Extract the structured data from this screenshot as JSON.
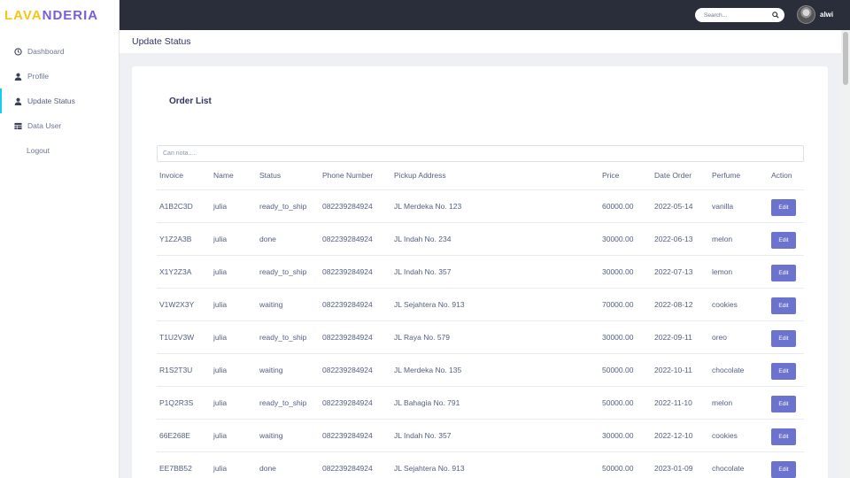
{
  "brand": {
    "name_part1": "LAVA",
    "name_part2": "NDERIA",
    "color_part1": "#f5c518",
    "color_part2": "#7b5cd6"
  },
  "sidebar": {
    "items": [
      {
        "label": "Dashboard",
        "icon": "clock-icon",
        "active": false
      },
      {
        "label": "Profile",
        "icon": "user-icon",
        "active": false
      },
      {
        "label": "Update Status",
        "icon": "user-icon",
        "active": true
      },
      {
        "label": "Data User",
        "icon": "table-icon",
        "active": false
      },
      {
        "label": "Logout",
        "icon": "",
        "active": false
      }
    ]
  },
  "topbar": {
    "search_placeholder": "Search...",
    "username": "alwi"
  },
  "page": {
    "title": "Update Status"
  },
  "orders": {
    "title": "Order List",
    "filter_placeholder": "Cari nota.....",
    "columns": [
      "Invoice",
      "Name",
      "Status",
      "Phone Number",
      "Pickup Address",
      "Price",
      "Date Order",
      "Perfume",
      "Action"
    ],
    "edit_label": "Edit",
    "rows": [
      [
        "A1B2C3D",
        "julia",
        "ready_to_ship",
        "082239284924",
        "JL Merdeka No. 123",
        "60000.00",
        "2022-05-14",
        "vanilla"
      ],
      [
        "Y1Z2A3B",
        "julia",
        "done",
        "082239284924",
        "JL Indah No. 234",
        "30000.00",
        "2022-06-13",
        "melon"
      ],
      [
        "X1Y2Z3A",
        "julia",
        "ready_to_ship",
        "082239284924",
        "JL Indah No. 357",
        "30000.00",
        "2022-07-13",
        "lemon"
      ],
      [
        "V1W2X3Y",
        "julia",
        "waiting",
        "082239284924",
        "JL Sejahtera No. 913",
        "70000.00",
        "2022-08-12",
        "cookies"
      ],
      [
        "T1U2V3W",
        "julia",
        "ready_to_ship",
        "082239284924",
        "JL Raya No. 579",
        "30000.00",
        "2022-09-11",
        "oreo"
      ],
      [
        "R1S2T3U",
        "julia",
        "waiting",
        "082239284924",
        "JL Merdeka No. 135",
        "50000.00",
        "2022-10-11",
        "chocolate"
      ],
      [
        "P1Q2R3S",
        "julia",
        "ready_to_ship",
        "082239284924",
        "JL Bahagia No. 791",
        "50000.00",
        "2022-11-10",
        "melon"
      ],
      [
        "66E268E",
        "julia",
        "waiting",
        "082239284924",
        "JL Indah No. 357",
        "30000.00",
        "2022-12-10",
        "cookies"
      ],
      [
        "EE7BB52",
        "julia",
        "done",
        "082239284924",
        "JL Sejahtera No. 913",
        "50000.00",
        "2023-01-09",
        "chocolate"
      ]
    ]
  }
}
